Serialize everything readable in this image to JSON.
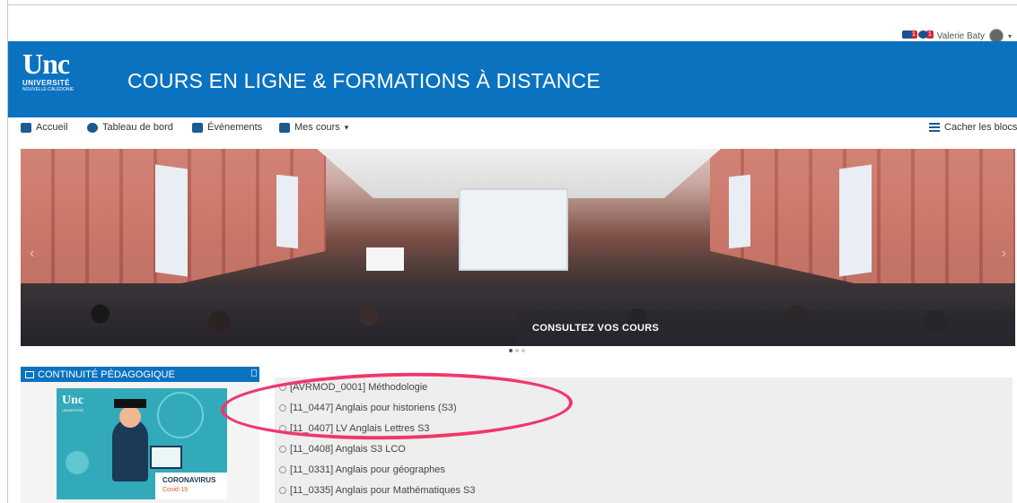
{
  "user": {
    "name": "Valerie Baty",
    "notifications_count": "1",
    "messages_count": "1"
  },
  "header": {
    "logo_mark": "Unc",
    "logo_university": "UNIVERSITÉ",
    "logo_region": "NOUVELLE-CALÉDONIE",
    "site_title": "COURS EN LIGNE & FORMATIONS À DISTANCE"
  },
  "nav": {
    "items": [
      {
        "label": "Accueil",
        "icon": "home-icon"
      },
      {
        "label": "Tableau de bord",
        "icon": "dashboard-icon"
      },
      {
        "label": "Événements",
        "icon": "calendar-icon"
      },
      {
        "label": "Mes cours",
        "icon": "briefcase-icon"
      }
    ],
    "hide_blocks": "Cacher les blocs"
  },
  "carousel": {
    "caption": "CONSULTEZ VOS COURS",
    "slide_count": 3,
    "active_slide": 1
  },
  "block": {
    "title": "CONTINUITÉ PÉDAGOGIQUE",
    "image_logo": "Unc",
    "image_logo_sub": "UNIVERSITÉ",
    "image_caption_1": "CORONAVIRUS",
    "image_caption_2": "Covid-19"
  },
  "courses": [
    "[AVRMOD_0001] Méthodologie",
    "[11_0447] Anglais pour historiens (S3)",
    "[11_0407] LV Anglais Lettres S3",
    "[11_0408] Anglais S3 LCO",
    "[11_0331] Anglais pour géographes",
    "[11_0335] Anglais pour Mathématiques S3"
  ],
  "colors": {
    "brand_blue": "#0b72c0",
    "highlight_pink": "#f0376b",
    "badge_red": "#d9262c"
  }
}
